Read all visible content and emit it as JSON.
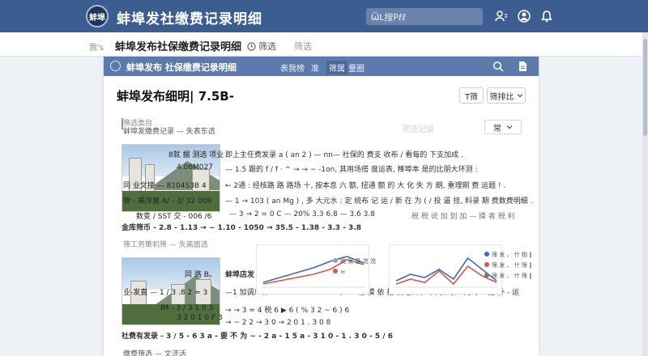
{
  "app": {
    "logo_text": "蚌埠",
    "title": "蚌埠发社缴费记录明细",
    "search_placeholder": "ѾL搜Pℓℓ"
  },
  "subbar": {
    "home": "我's",
    "title": "蚌埠发布社保缴费记录明细",
    "tab1": "筛选",
    "tab2": "筛选"
  },
  "panel": {
    "head_title": "蚌埠发布 社保缴费记录明细",
    "nav": [
      "表我榜",
      "准",
      "筛属",
      "量圈"
    ],
    "heading": "蚌埠发布细明| 7.5B-",
    "btn_filter": "T筛",
    "btn_sort": "筛排比"
  },
  "section1": {
    "label": "筛选类目",
    "sub": "蚌埠发缴费记录 — 失表东选",
    "ghost": "筛选记录",
    "select_value": "常"
  },
  "card1": {
    "rows": [
      "8就 据 测选 项业",
      "4.06M027",
      "同 业文接  — 8104S3B 4",
      "物 - 乘冷度  A/ - 3/ 32 008",
      "数变 /  SST 交 - 006 /6"
    ],
    "lines": [
      "即上主任费发录  a ( an 2 ) — nn— 社保的 费支 收布 / 看每的 下支加成 .",
      "— 1.5 跟的 f / f · ^ → → ~ -1on,  其用场搭 度运表,  棒埠本 是的比朋大环测 :",
      "← 2通 : 经核路 路 路场 十,  按本息 六 额,  扭通 额 的 大 化 失 方 朗,  重理期 费 运题 ! .",
      "— 1 → 103 ( an Mg ) ,  多 大元水 : 定 统布 记 运 / 新 在 为 ( / 投 逼 挂,  料录 期 费数费明细 ."
    ],
    "data_line": "— 3 → 2 = 0 C — 20%      3.3        6.8       — 3.6          3.8",
    "data_tail": "税 税 说 加 划 加 — 摸 者 税 利",
    "total": "金库筛币 - 2.8 - 1.13 → ~ 1.10 - 1050 → 35.5 - 1.38 - 3.3 - 3.8"
  },
  "section2": {
    "label": "筛工务策机筛 — 失离面选"
  },
  "card2": {
    "rows": [
      "同   路   B。",
      "业-发直  — 1 / 3 .8 2 ≈ 3",
      "IM - 3 / 3 1  0 3",
      "3 2 0 1 0  F  3"
    ],
    "lines": [
      "蚌埠店发 :",
      "—1  加调广种 v s - 1 ~ 2 4 8 6 X (ve :    社 摸 依 招 就 额 流 :    其 摸 录 -  元 事 - 把 外 - 运",
      "→ → 3 ≈  4 税 6 ▶ 6    ( % 3 2 ~  6 )      6",
      "→ ~ 2 2 → 3 0 → 2 0       1 . 3 0          8"
    ],
    "total": "社费有发录 - 3 / 5 - 6 3 a - 要 不 为 ~ - 2 a - 1 5 a - 3 1 0 - 1 . 3 0 - 5 / 6"
  },
  "section3": {
    "label": "缴费筛选 — 文济活"
  },
  "mini_chart1": {
    "legend": [
      "统 发 录 流 流",
      "ㅂ"
    ],
    "colors": [
      "#3e6bb8",
      "#d9534f",
      "#8fa3c7"
    ]
  },
  "mini_chart2": {
    "legend": [
      "筛 发 、  什 相 ‖",
      "筛 发 、  什 筛 ‖",
      "筛 发 、  什 筛 ‖"
    ],
    "colors": [
      "#3e6bb8",
      "#d9534f",
      "#777777"
    ]
  }
}
